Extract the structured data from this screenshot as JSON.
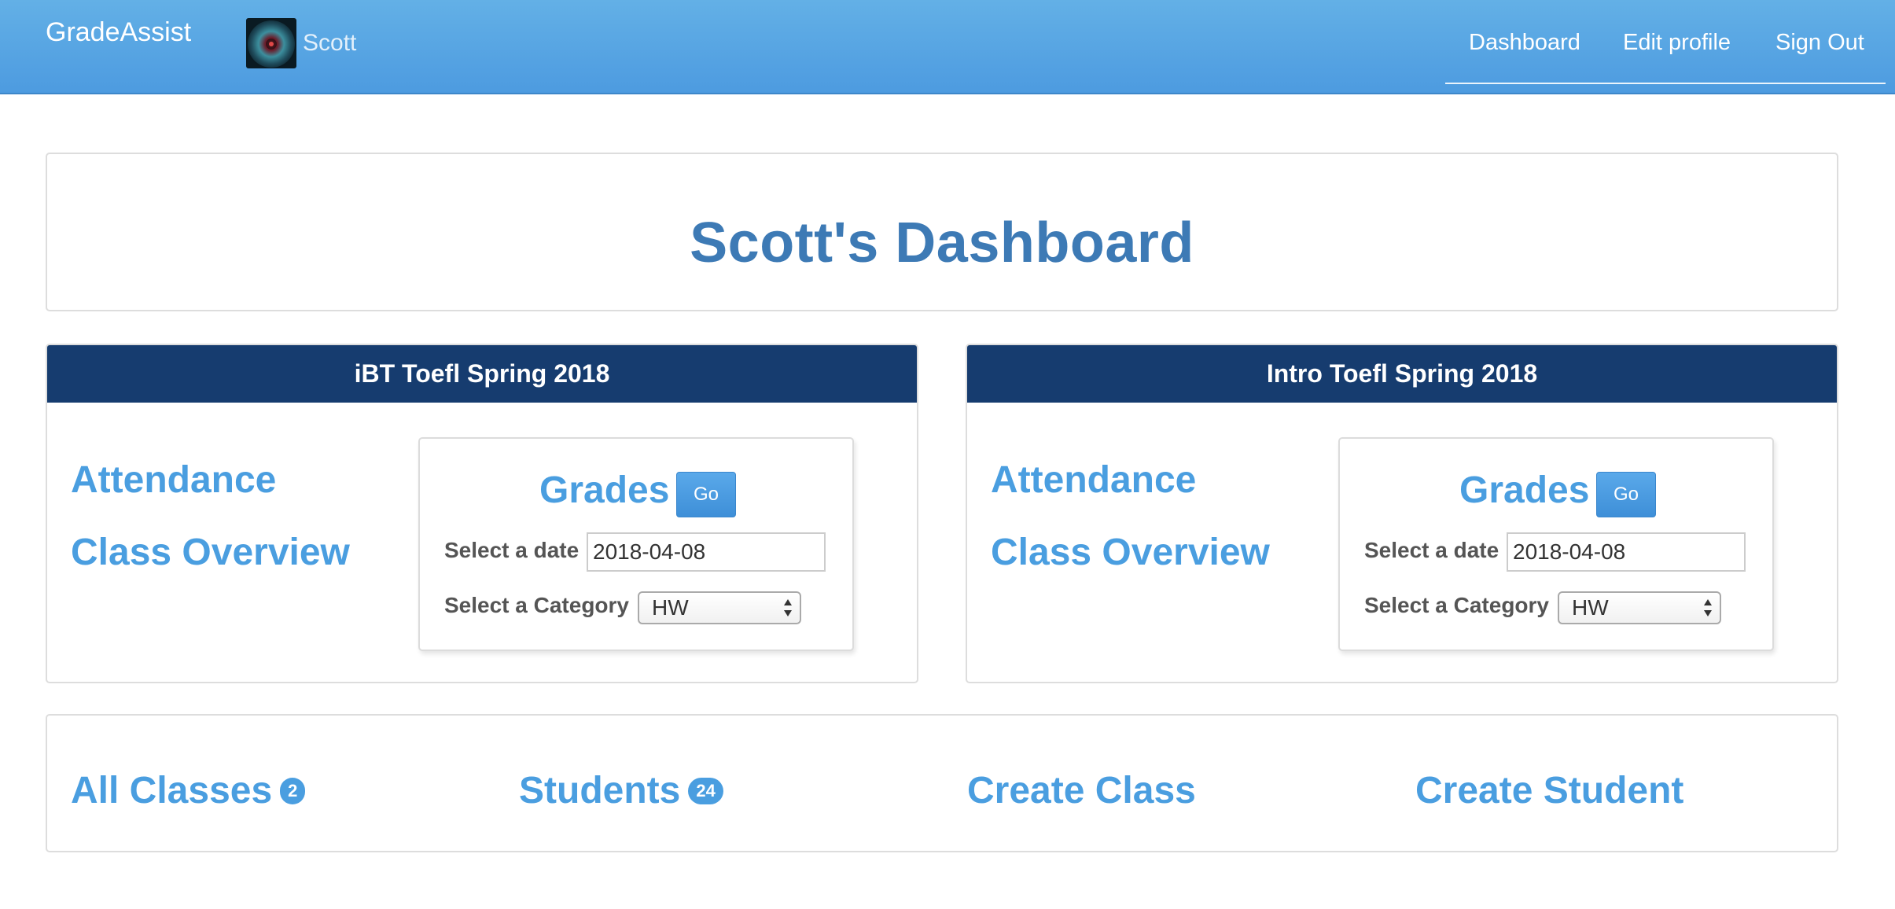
{
  "navbar": {
    "brand": "GradeAssist",
    "user_name": "Scott",
    "links": [
      "Dashboard",
      "Edit profile",
      "Sign Out"
    ]
  },
  "page_title": "Scott's Dashboard",
  "classes": [
    {
      "name": "iBT Toefl Spring 2018",
      "attendance_label": "Attendance",
      "overview_label": "Class Overview",
      "grades_label": "Grades",
      "go_label": "Go",
      "date_label": "Select a date",
      "date_value": "2018-04-08",
      "category_label": "Select a Category",
      "category_value": "HW"
    },
    {
      "name": "Intro Toefl Spring 2018",
      "attendance_label": "Attendance",
      "overview_label": "Class Overview",
      "grades_label": "Grades",
      "go_label": "Go",
      "date_label": "Select a date",
      "date_value": "2018-04-08",
      "category_label": "Select a Category",
      "category_value": "HW"
    }
  ],
  "bottom_links": {
    "all_classes": {
      "label": "All Classes",
      "count": "2"
    },
    "students": {
      "label": "Students",
      "count": "24"
    },
    "create_class": {
      "label": "Create Class"
    },
    "create_student": {
      "label": "Create Student"
    }
  },
  "colors": {
    "navbar": "#4d9be0",
    "class_header": "#163c6f",
    "link": "#4a9ee0",
    "title": "#3d7ab5"
  },
  "icons": {
    "avatar": "nebula-avatar-image",
    "select": "select-up-down-arrows-icon"
  }
}
